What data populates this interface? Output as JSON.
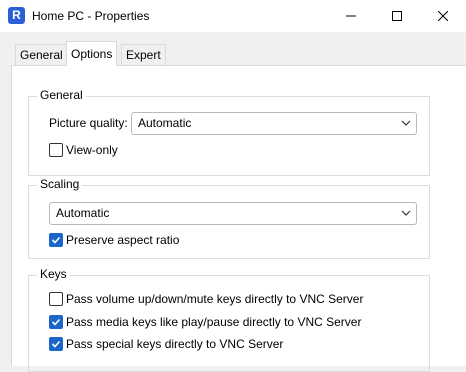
{
  "window": {
    "title": "Home PC - Properties",
    "app_icon_letter": "R",
    "accent_color": "#1a66c9"
  },
  "tabs": [
    {
      "label": "General",
      "active": false
    },
    {
      "label": "Options",
      "active": true
    },
    {
      "label": "Expert",
      "active": false
    }
  ],
  "general": {
    "title": "General",
    "picture_quality_label": "Picture quality:",
    "picture_quality_value": "Automatic",
    "view_only_label": "View-only",
    "view_only_checked": false
  },
  "scaling": {
    "title": "Scaling",
    "value": "Automatic",
    "preserve_label": "Preserve aspect ratio",
    "preserve_checked": true
  },
  "keys": {
    "title": "Keys",
    "items": [
      {
        "label": "Pass volume up/down/mute keys directly to VNC Server",
        "checked": false
      },
      {
        "label": "Pass media keys like play/pause directly to VNC Server",
        "checked": true
      },
      {
        "label": "Pass special keys directly to VNC Server",
        "checked": true
      }
    ]
  }
}
